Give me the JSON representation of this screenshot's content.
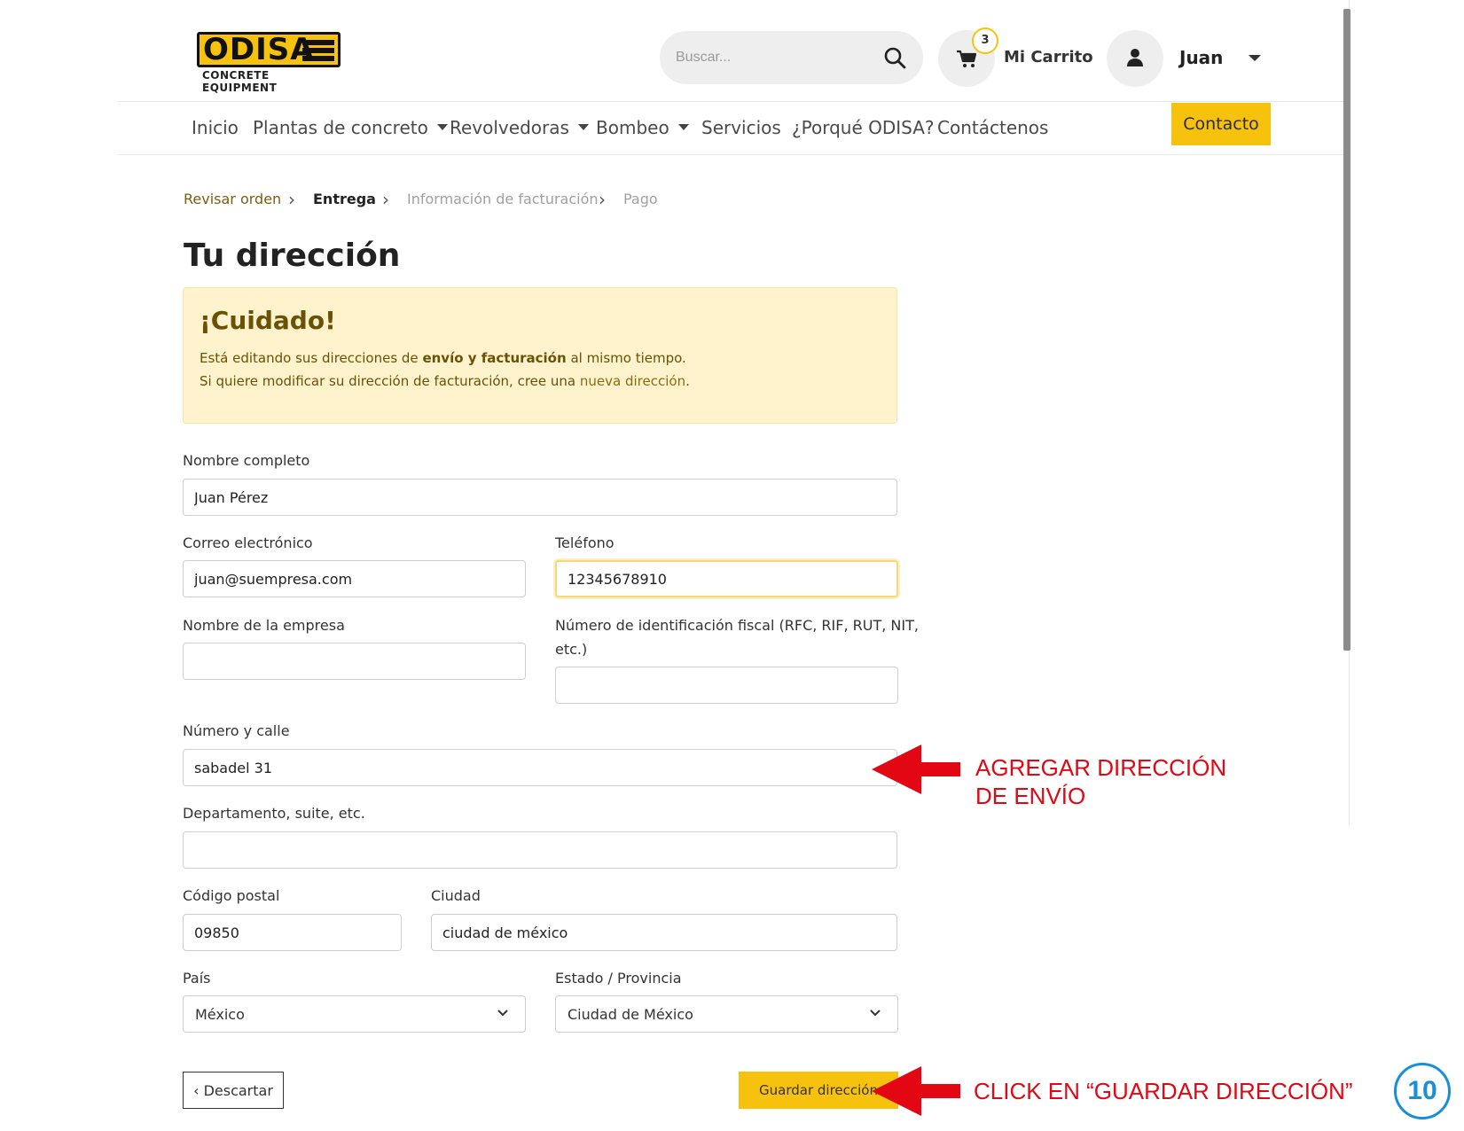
{
  "header": {
    "logo_text": "ODISA",
    "logo_sub": "CONCRETE EQUIPMENT",
    "search_placeholder": "Buscar...",
    "cart_count": "3",
    "cart_label": "Mi Carrito",
    "user_name": "Juan"
  },
  "nav": {
    "items": [
      "Inicio",
      "Plantas de concreto",
      "Revolvedoras",
      "Bombeo",
      "Servicios",
      "¿Porqué ODISA?",
      "Contáctenos"
    ],
    "contact_button": "Contacto"
  },
  "breadcrumb": [
    "Revisar orden",
    "Entrega",
    "Información de facturación",
    "Pago"
  ],
  "page_title": "Tu dirección",
  "alert": {
    "title": "¡Cuidado!",
    "line1_pre": "Está editando sus direcciones de ",
    "line1_bold": "envío y facturación",
    "line1_post": " al mismo tiempo.",
    "line2_pre": "Si quiere modificar su dirección de facturación, cree una ",
    "line2_link": "nueva dirección",
    "line2_post": "."
  },
  "form": {
    "full_name_label": "Nombre completo",
    "full_name_value": "Juan Pérez",
    "email_label": "Correo electrónico",
    "email_value": "juan@suempresa.com",
    "phone_label": "Teléfono",
    "phone_value": "12345678910",
    "company_label": "Nombre de la empresa",
    "company_value": "",
    "tax_id_label_1": "Número de identificación fiscal (RFC, RIF, RUT, NIT,",
    "tax_id_label_2": "etc.)",
    "tax_id_value": "",
    "street_label": "Número y calle",
    "street_value": "sabadel 31",
    "apt_label": "Departamento, suite, etc.",
    "apt_value": "",
    "zip_label": "Código postal",
    "zip_value": "09850",
    "city_label": "Ciudad",
    "city_value": "ciudad de méxico",
    "country_label": "País",
    "country_value": "México",
    "state_label": "Estado / Provincia",
    "state_value": "Ciudad de México",
    "discard_label": "Descartar",
    "save_label": "Guardar dirección"
  },
  "annotations": {
    "add_address_line1": "AGREGAR DIRECCIÓN",
    "add_address_line2": "DE ENVÍO",
    "click_save": "CLICK EN “GUARDAR DIRECCIÓN”",
    "step_number": "10"
  },
  "colors": {
    "brand_yellow": "#f7c20e",
    "alert_bg": "#fff3cd",
    "alert_text": "#6b5105",
    "annotation_red": "#e30613",
    "step_blue": "#1a8fd6"
  }
}
